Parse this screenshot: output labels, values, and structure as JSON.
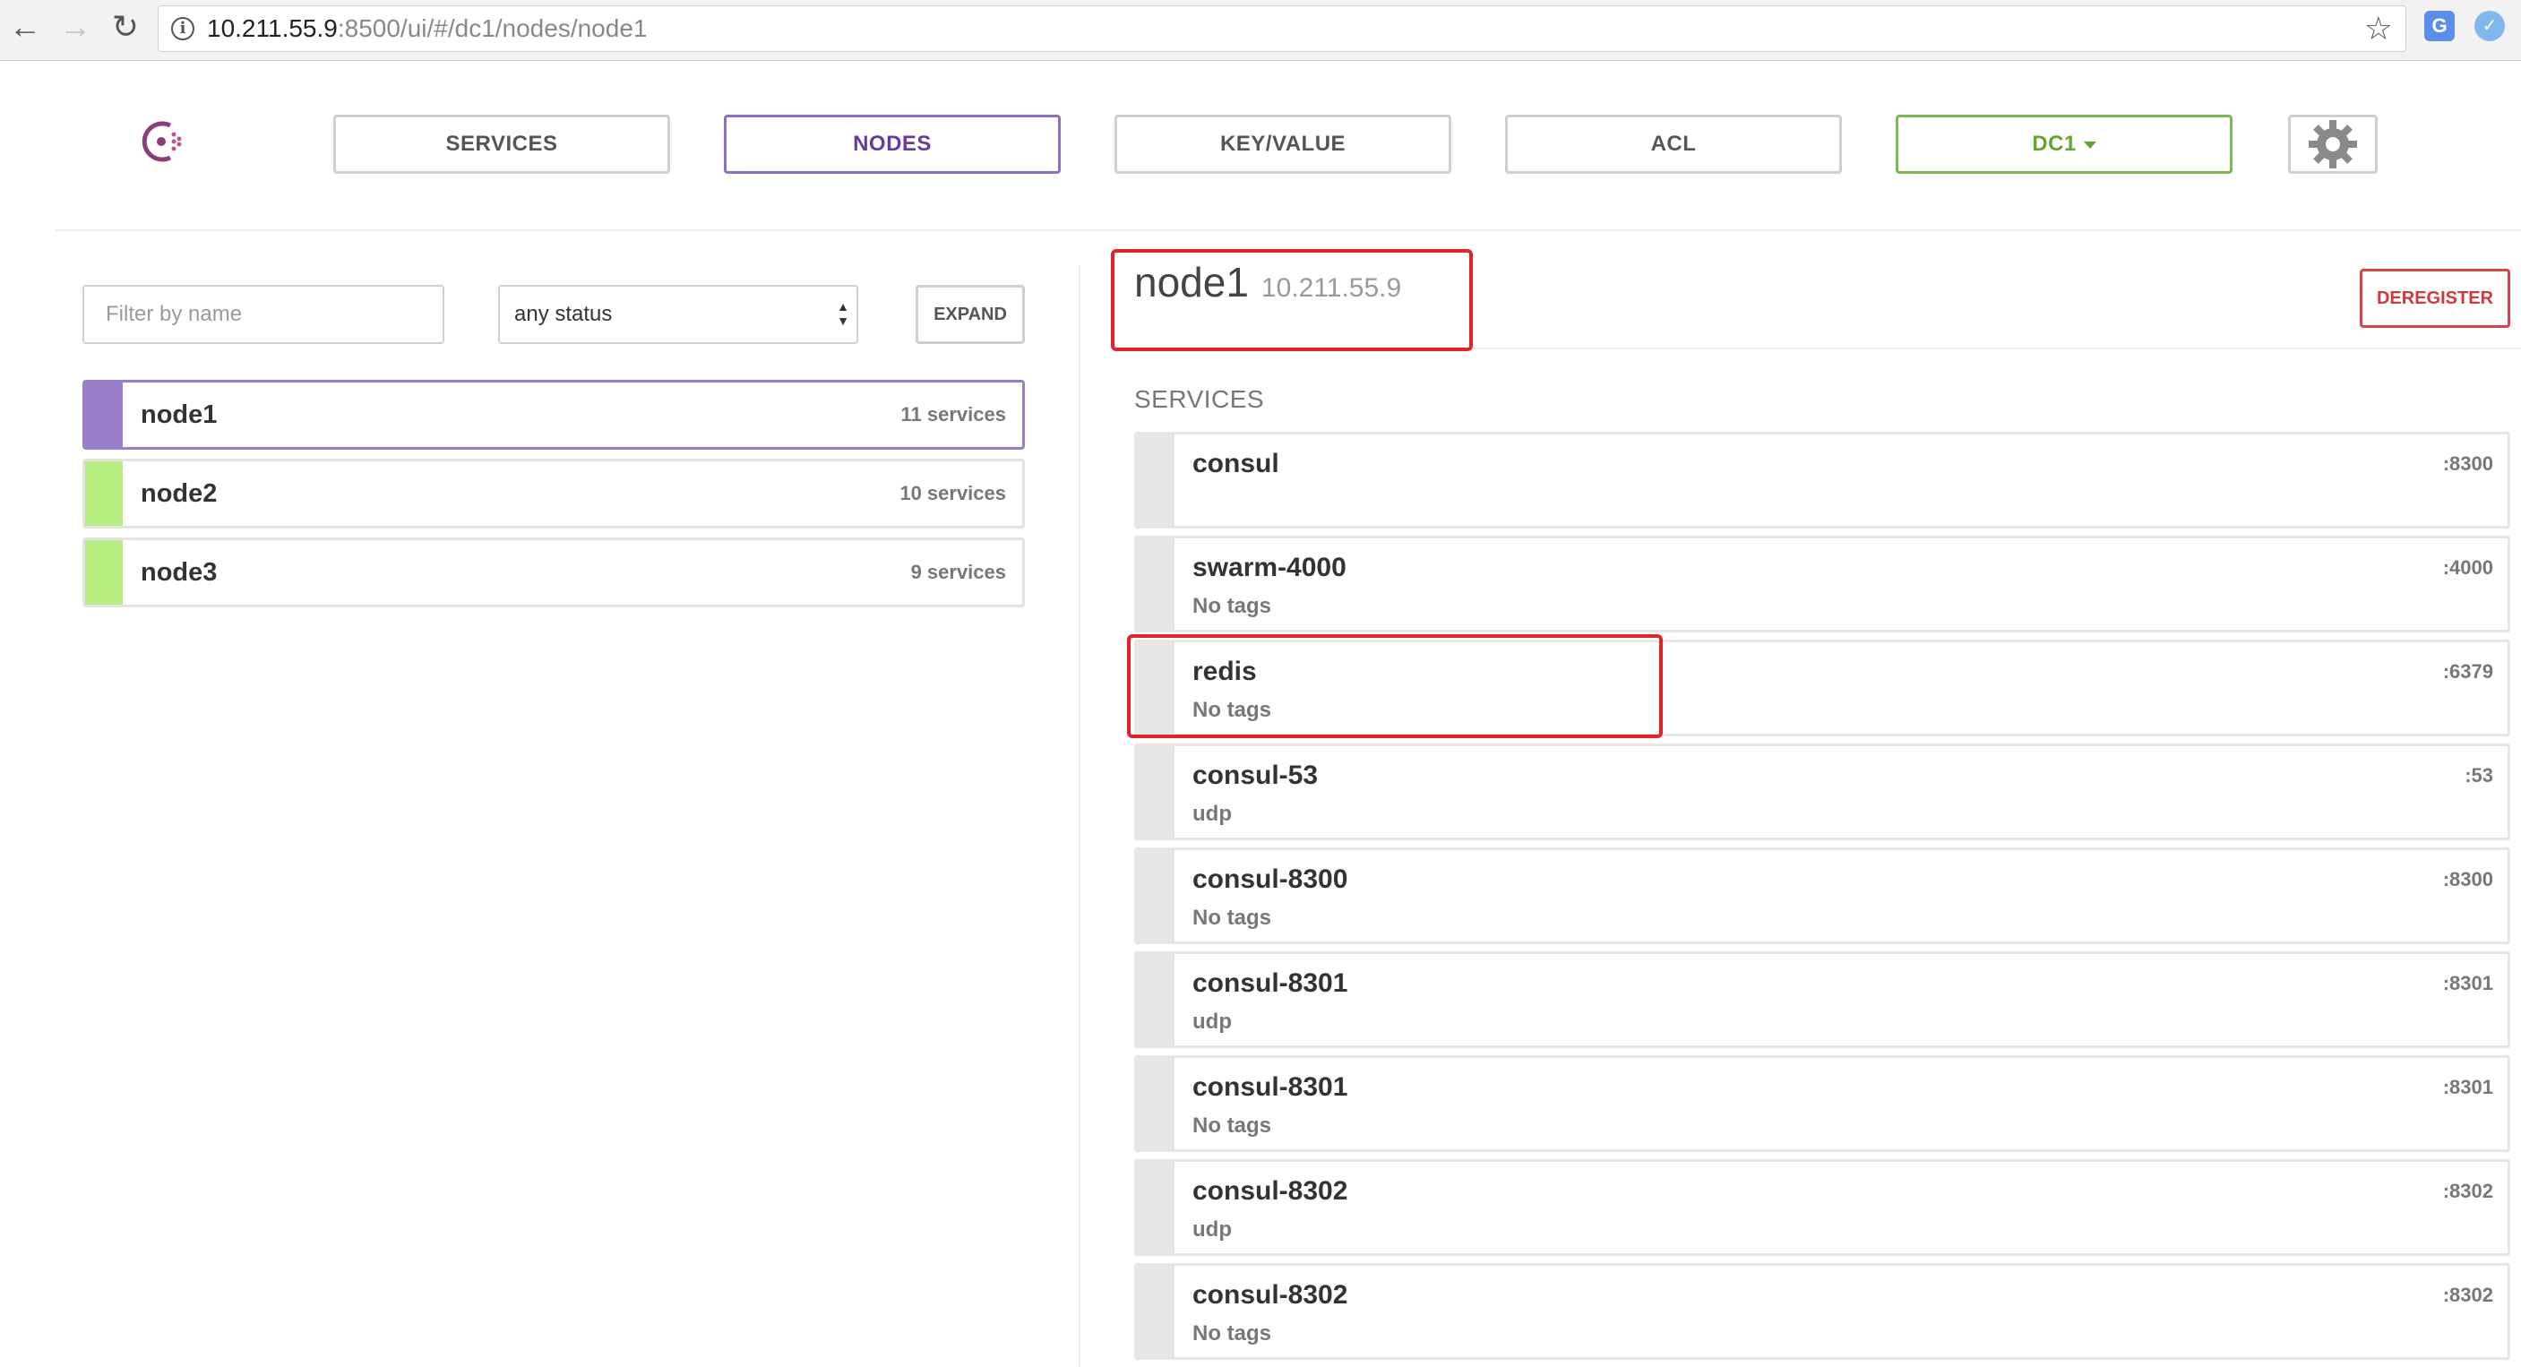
{
  "browser": {
    "url_host": "10.211.55.9",
    "url_rest": ":8500/ui/#/dc1/nodes/node1"
  },
  "topnav": {
    "services": "SERVICES",
    "nodes": "NODES",
    "keyvalue": "KEY/VALUE",
    "acl": "ACL",
    "datacenter": "DC1"
  },
  "filters": {
    "name_placeholder": "Filter by name",
    "status_value": "any status",
    "expand_label": "EXPAND"
  },
  "nodes": [
    {
      "name": "node1",
      "services": "11 services",
      "status_color": "#9b7dc9"
    },
    {
      "name": "node2",
      "services": "10 services",
      "status_color": "#b6ee80"
    },
    {
      "name": "node3",
      "services": "9 services",
      "status_color": "#b6ee80"
    }
  ],
  "detail": {
    "node_name": "node1",
    "node_ip": "10.211.55.9",
    "deregister_label": "DEREGISTER",
    "services_heading": "SERVICES"
  },
  "services": [
    {
      "name": "consul",
      "tags": "",
      "port": ":8300"
    },
    {
      "name": "swarm-4000",
      "tags": "No tags",
      "port": ":4000"
    },
    {
      "name": "redis",
      "tags": "No tags",
      "port": ":6379"
    },
    {
      "name": "consul-53",
      "tags": "udp",
      "port": ":53"
    },
    {
      "name": "consul-8300",
      "tags": "No tags",
      "port": ":8300"
    },
    {
      "name": "consul-8301",
      "tags": "udp",
      "port": ":8301"
    },
    {
      "name": "consul-8301",
      "tags": "No tags",
      "port": ":8301"
    },
    {
      "name": "consul-8302",
      "tags": "udp",
      "port": ":8302"
    },
    {
      "name": "consul-8302",
      "tags": "No tags",
      "port": ":8302"
    }
  ],
  "colors": {
    "accent_purple": "#8e6fbf",
    "passing_green": "#b6ee80",
    "danger_red": "#d8434a",
    "annotation_red": "#e0242c"
  }
}
